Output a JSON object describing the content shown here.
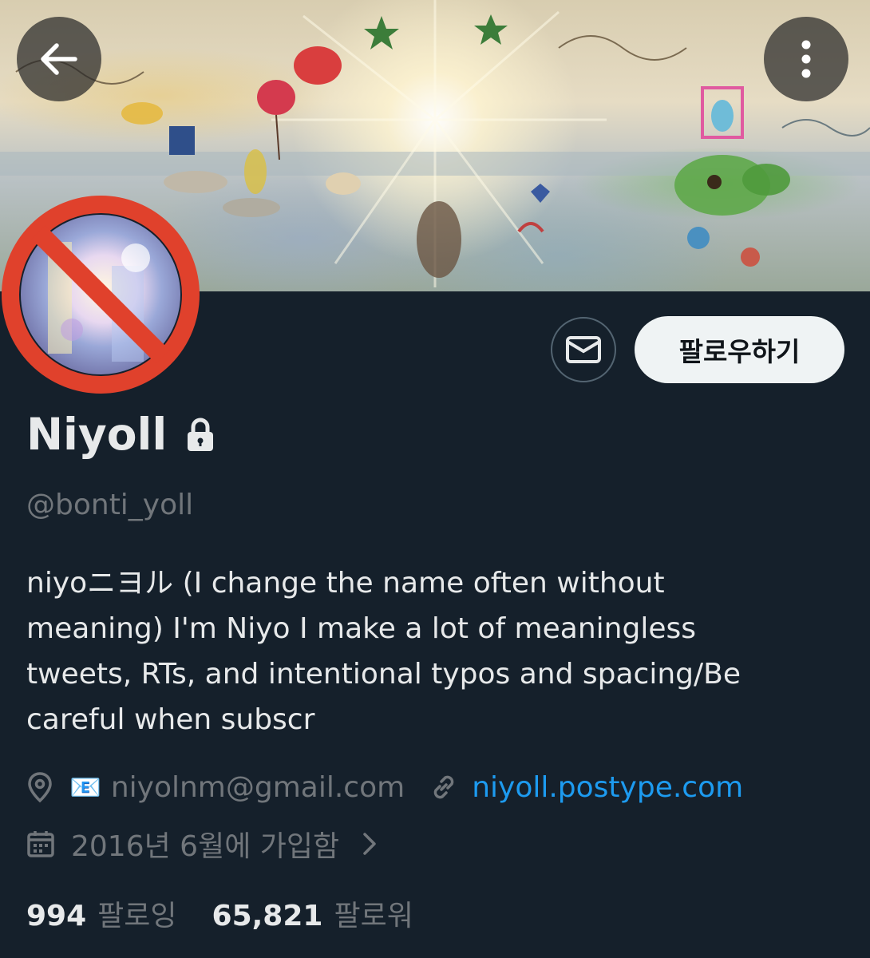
{
  "profile": {
    "display_name": "Niyoll",
    "handle": "@bonti_yoll",
    "bio_lines": [
      "niyoニヨル (I change the name often without",
      "meaning) I'm Niyo I make a lot of meaningless",
      "tweets, RTs, and intentional typos and spacing/Be",
      "careful when subscr"
    ],
    "email_emoji": "📧",
    "email": "niyolnm@gmail.com",
    "website": "niyoll.postype.com",
    "joined": "2016년 6월에 가입함",
    "following_count": "994",
    "following_label": "팔로잉",
    "followers_count": "65,821",
    "followers_label": "팔로워",
    "protected": true
  },
  "actions": {
    "follow_label": "팔로우하기"
  },
  "icons": {
    "back": "arrow-left-icon",
    "more": "more-vertical-icon",
    "message": "envelope-icon",
    "lock": "lock-icon",
    "location": "location-pin-icon",
    "link": "link-icon",
    "calendar": "calendar-icon",
    "chevron": "chevron-right-icon",
    "avatar_overlay": "prohibited-icon"
  },
  "colors": {
    "background": "#15202b",
    "text_primary": "#e7e9ea",
    "text_secondary": "#71767b",
    "link": "#1d9bf0",
    "prohibited_red": "#e0412c"
  }
}
